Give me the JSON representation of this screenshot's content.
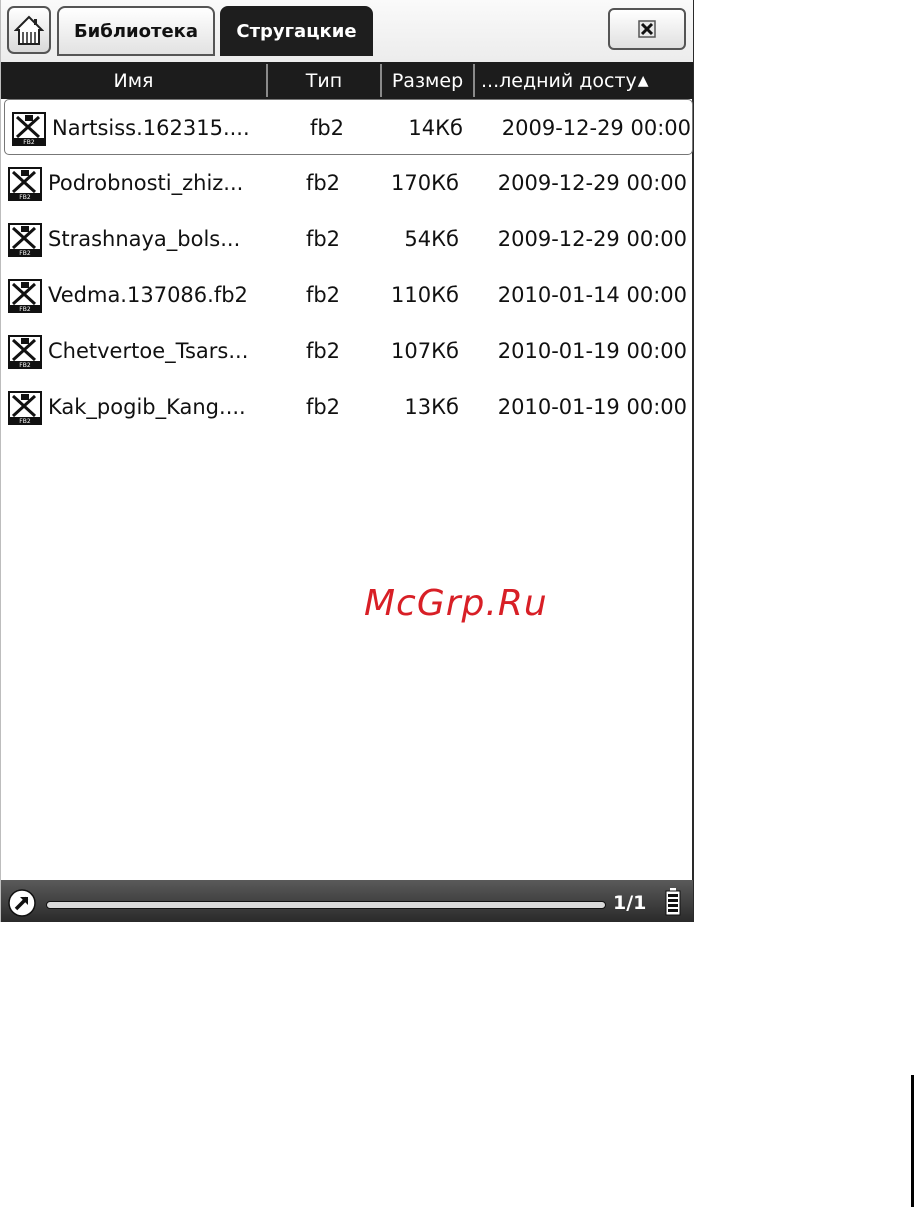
{
  "tabs": [
    {
      "label": "Библиотека",
      "active": false
    },
    {
      "label": "Стругацкие",
      "active": true
    }
  ],
  "columns": {
    "name": "Имя",
    "type": "Тип",
    "size": "Размер",
    "date": "...ледний досту"
  },
  "sort": {
    "column": "date",
    "direction": "ascending",
    "indicator": "▲"
  },
  "files": [
    {
      "name": "Nartsiss.162315....",
      "type": "fb2",
      "size": "14Кб",
      "date": "2009-12-29 00:00",
      "icon": "fb2-file-icon",
      "selected": true
    },
    {
      "name": "Podrobnosti_zhiz...",
      "type": "fb2",
      "size": "170Кб",
      "date": "2009-12-29 00:00",
      "icon": "fb2-file-icon",
      "selected": false
    },
    {
      "name": "Strashnaya_bols...",
      "type": "fb2",
      "size": "54Кб",
      "date": "2009-12-29 00:00",
      "icon": "fb2-file-icon",
      "selected": false
    },
    {
      "name": "Vedma.137086.fb2",
      "type": "fb2",
      "size": "110Кб",
      "date": "2010-01-14 00:00",
      "icon": "fb2-file-icon",
      "selected": false
    },
    {
      "name": "Chetvertoe_Tsars...",
      "type": "fb2",
      "size": "107Кб",
      "date": "2010-01-19 00:00",
      "icon": "fb2-file-icon",
      "selected": false
    },
    {
      "name": "Kak_pogib_Kang....",
      "type": "fb2",
      "size": "13Кб",
      "date": "2010-01-19 00:00",
      "icon": "fb2-file-icon",
      "selected": false
    }
  ],
  "footer": {
    "page": "1/1",
    "battery": "full"
  },
  "watermark": "McGrp.Ru",
  "colors": {
    "header_bg": "#1c1c1c",
    "active_tab_bg": "#1e1e1e",
    "watermark": "#d81f26"
  }
}
